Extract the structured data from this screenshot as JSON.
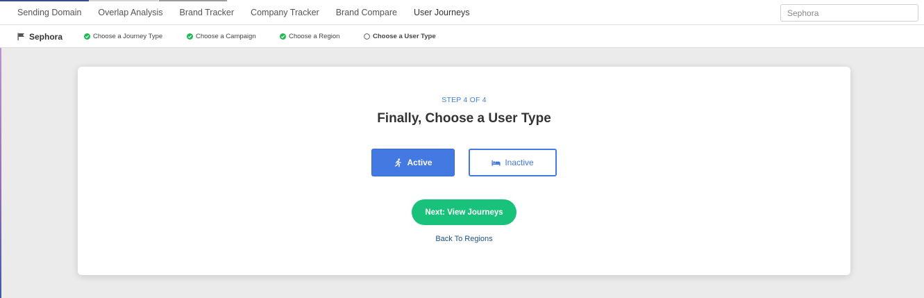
{
  "nav": {
    "tabs": [
      {
        "label": "Sending Domain"
      },
      {
        "label": "Overlap Analysis"
      },
      {
        "label": "Brand Tracker"
      },
      {
        "label": "Company Tracker"
      },
      {
        "label": "Brand Compare"
      },
      {
        "label": "User Journeys"
      }
    ],
    "search": {
      "value": "",
      "placeholder": "Sephora"
    }
  },
  "breadcrumb": {
    "brand": "Sephora",
    "steps": [
      {
        "label": "Choose a Journey Type",
        "status": "complete"
      },
      {
        "label": "Choose a Campaign",
        "status": "complete"
      },
      {
        "label": "Choose a Region",
        "status": "complete"
      },
      {
        "label": "Choose a User Type",
        "status": "current"
      }
    ]
  },
  "card": {
    "step_label": "STEP 4 OF 4",
    "title": "Finally, Choose a User Type",
    "options": [
      {
        "label": "Active",
        "icon": "running-person-icon",
        "selected": true
      },
      {
        "label": "Inactive",
        "icon": "bed-icon",
        "selected": false
      }
    ],
    "next_label": "Next: View Journeys",
    "back_label": "Back To Regions"
  },
  "colors": {
    "accent_blue": "#4479e1",
    "success_green": "#19c27a",
    "check_green": "#1db954",
    "link_blue": "#1a4f8a",
    "step_blue": "#3f7fdb",
    "background": "#ebebeb"
  }
}
